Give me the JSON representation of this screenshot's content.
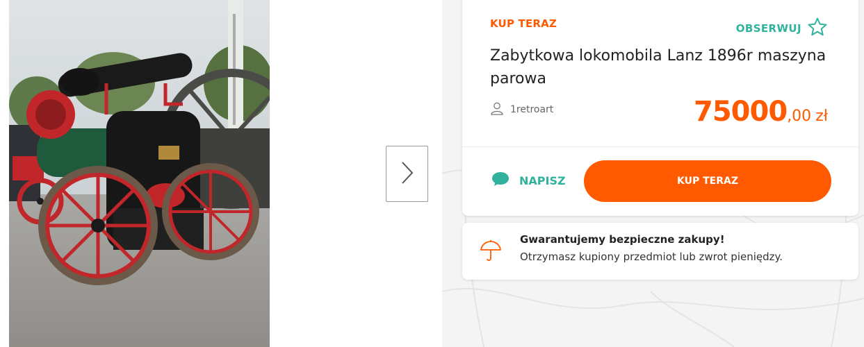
{
  "gallery": {
    "photo_alt": "Zabytkowa lokomobila Lanz 1896r maszyna parowa",
    "next_icon": "chevron-right-icon"
  },
  "offer": {
    "type_label": "KUP TERAZ",
    "observe_label": "OBSERWUJ",
    "observe_icon": "star-icon",
    "title": "Zabytkowa lokomobila Lanz 1896r maszyna parowa",
    "seller_icon": "user-icon",
    "seller": "1retroart",
    "price_int": "75000",
    "price_dec": ",00",
    "currency": "zł",
    "write_icon": "chat-bubble-icon",
    "write_label": "NAPISZ",
    "buy_button": "KUP TERAZ"
  },
  "guarantee": {
    "icon": "umbrella-icon",
    "title": "Gwarantujemy bezpieczne zakupy!",
    "text": "Otrzymasz kupiony przedmiot lub zwrot pieniędzy."
  },
  "colors": {
    "accent_orange": "#ff5a00",
    "accent_teal": "#30b29c",
    "text_dark": "#222222",
    "background": "#f4f4f4"
  }
}
